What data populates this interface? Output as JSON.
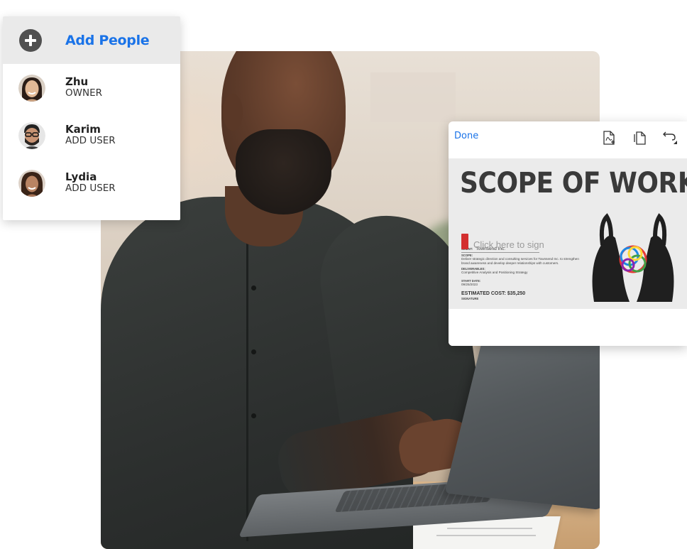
{
  "people_panel": {
    "add_label": "Add People",
    "people": [
      {
        "name": "Zhu",
        "role": "OWNER",
        "avatar": "avatar-zhu"
      },
      {
        "name": "Karim",
        "role": "ADD USER",
        "avatar": "avatar-karim"
      },
      {
        "name": "Lydia",
        "role": "ADD USER",
        "avatar": "avatar-lydia"
      }
    ]
  },
  "document": {
    "done_label": "Done",
    "toolbar_icons": [
      "add-pdf-icon",
      "copy-page-icon",
      "undo-icon"
    ],
    "title": "SCOPE OF WORK",
    "client_label": "CLIENT:",
    "client_value": "Townsend Inc.",
    "scope_label": "SCOPE:",
    "scope_text_1": "Deliver strategic direction and consulting services for Townsend Inc. to strengthen",
    "scope_text_2": "brand awareness and develop deeper relationships with customers.",
    "deliverables_label": "DELIVERABLES:",
    "deliverables_text": "Competitive Analysis and Positioning Strategy",
    "start_date_label": "START DATE:",
    "start_date_value": "09/25/2023",
    "estimated_cost": "ESTIMATED COST: $35,250",
    "signature_placeholder": "Click here to sign",
    "signature_label": "SIGNATURE"
  },
  "colors": {
    "accent_blue": "#1a73e8",
    "add_row_bg": "#eaeaea",
    "plus_icon": "#505050",
    "doc_page_bg": "#ebebeb"
  }
}
